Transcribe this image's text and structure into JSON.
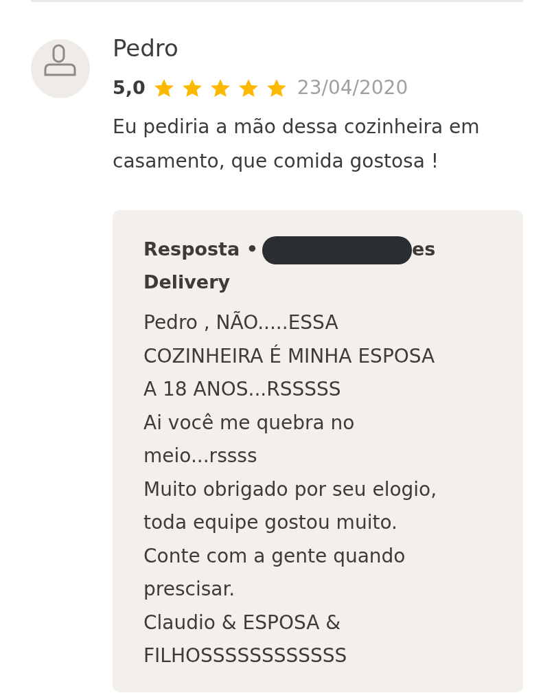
{
  "review": {
    "author": "Pedro",
    "rating": "5,0",
    "stars": 5,
    "date": "23/04/2020",
    "text": "Eu pediria a mão dessa cozinheira em\ncasamento, que comida gostosa !"
  },
  "reply": {
    "label": "Resposta •",
    "redacted": true,
    "author_fragments": [
      "es",
      "Delivery"
    ],
    "text": "Pedro , NÃO.....ESSA\nCOZINHEIRA É MINHA ESPOSA\nA 18 ANOS...RSSSSS\nAi você me quebra no\nmeio...rssss\nMuito obrigado por seu elogio,\ntoda equipe gostou muito.\nConte com a gente quando\nprescisar.\nClaudio & ESPOSA &\nFILHOSSSSSSSSSSSS"
  }
}
